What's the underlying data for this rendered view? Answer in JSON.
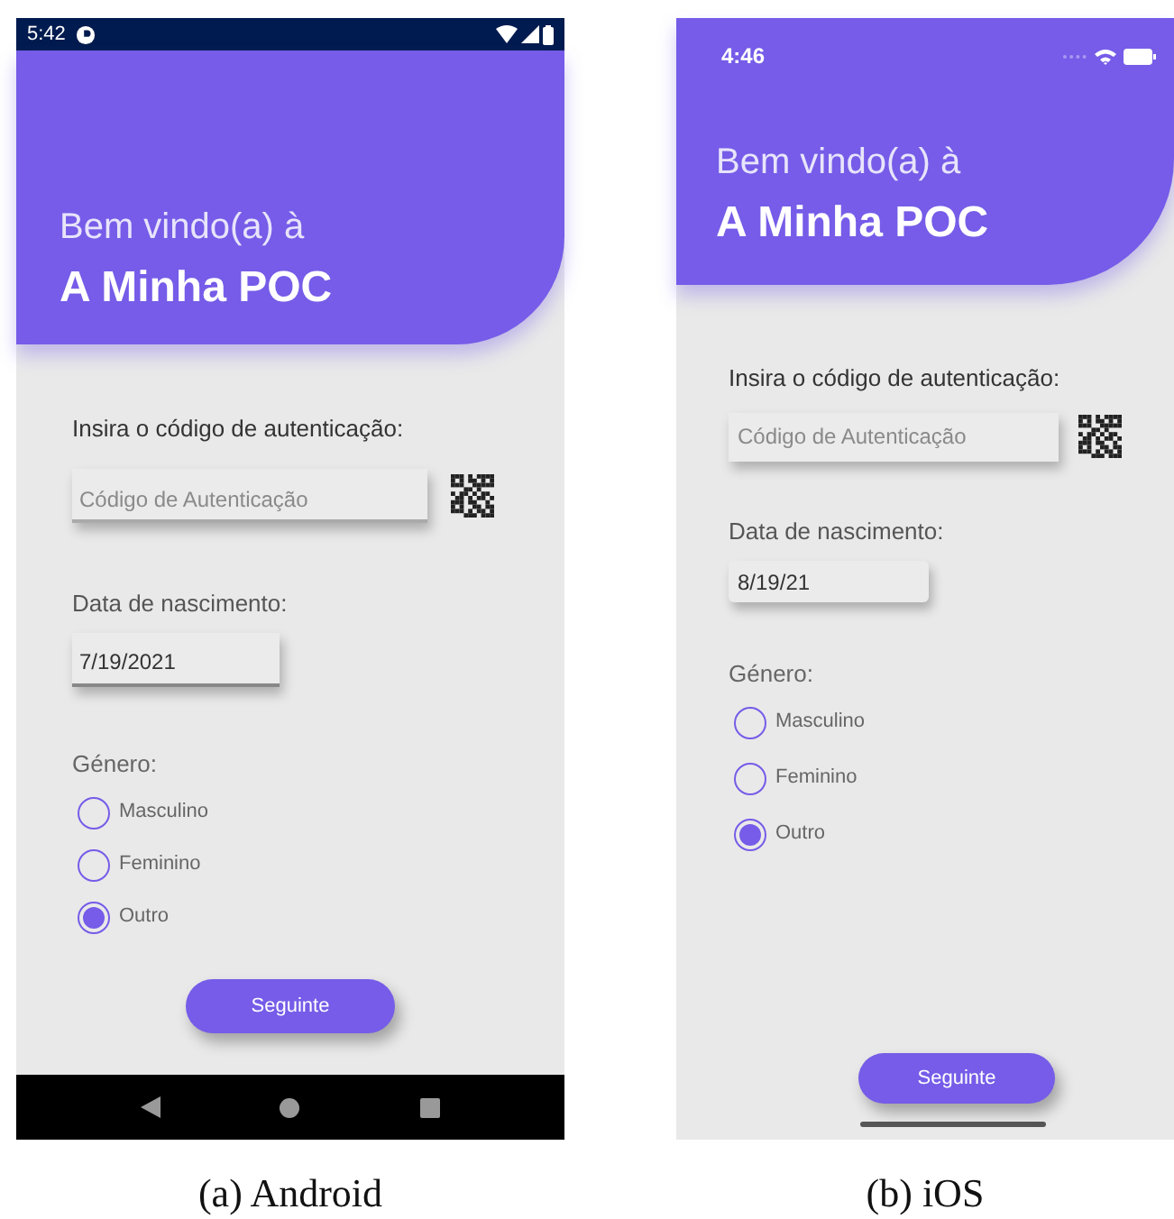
{
  "screens": [
    {
      "kind": "android",
      "status_bar": {
        "time": "5:42"
      },
      "header": {
        "greeting": "Bem vindo(a) à",
        "title": "A Minha POC"
      },
      "auth": {
        "label": "Insira o código de autenticação:",
        "placeholder": "Código de Autenticação"
      },
      "birth": {
        "label": "Data de nascimento:",
        "value": "7/19/2021"
      },
      "gender": {
        "label": "Género:",
        "options": [
          {
            "label": "Masculino",
            "selected": false
          },
          {
            "label": "Feminino",
            "selected": false
          },
          {
            "label": "Outro",
            "selected": true
          }
        ]
      },
      "button": "Seguinte",
      "caption": "(a) Android"
    },
    {
      "kind": "ios",
      "status_bar": {
        "time": "4:46"
      },
      "header": {
        "greeting": "Bem vindo(a) à",
        "title": "A Minha POC"
      },
      "auth": {
        "label": "Insira o código de autenticação:",
        "placeholder": "Código de Autenticação"
      },
      "birth": {
        "label": "Data de nascimento:",
        "value": "8/19/21"
      },
      "gender": {
        "label": "Género:",
        "options": [
          {
            "label": "Masculino",
            "selected": false
          },
          {
            "label": "Feminino",
            "selected": false
          },
          {
            "label": "Outro",
            "selected": true
          }
        ]
      },
      "button": "Seguinte",
      "caption": "(b) iOS"
    }
  ]
}
